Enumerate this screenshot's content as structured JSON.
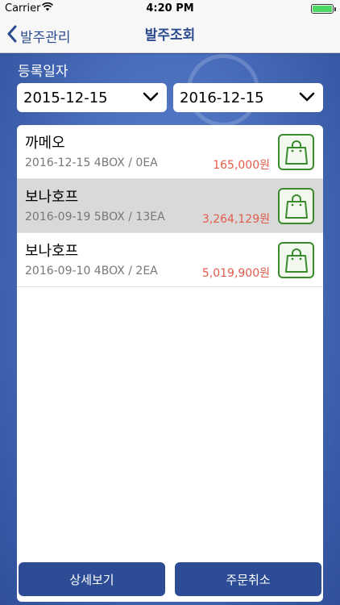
{
  "status_bar": {
    "carrier": "Carrier",
    "time": "4:20 PM",
    "wifi_icon": "wifi-icon",
    "battery_icon": "battery-icon"
  },
  "nav": {
    "back_label": "발주관리",
    "title": "발주조회"
  },
  "filter": {
    "label": "등록일자",
    "from_date": "2015-12-15",
    "to_date": "2016-12-15"
  },
  "orders": [
    {
      "name": "까메오",
      "meta": "2016-12-15 4BOX / 0EA",
      "amount": "165,000원",
      "selected": false
    },
    {
      "name": "보나호프",
      "meta": "2016-09-19 5BOX / 13EA",
      "amount": "3,264,129원",
      "selected": true
    },
    {
      "name": "보나호프",
      "meta": "2016-09-10 4BOX / 2EA",
      "amount": "5,019,900원",
      "selected": false
    }
  ],
  "buttons": {
    "detail": "상세보기",
    "cancel_order": "주문취소"
  },
  "colors": {
    "accent": "#2a4a8f",
    "amount": "#e25b4b",
    "bag_icon": "#3a8a2e",
    "background": "#2e4e97"
  }
}
